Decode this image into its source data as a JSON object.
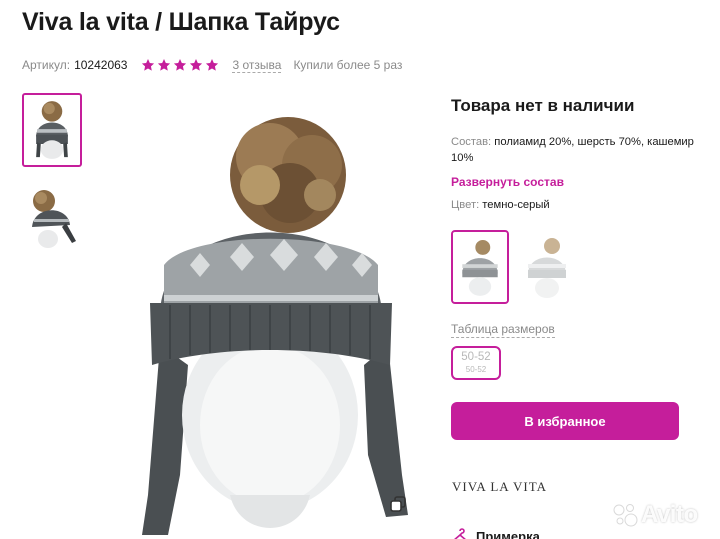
{
  "product": {
    "title": "Viva la vita / Шапка Тайрус",
    "sku_label": "Артикул:",
    "sku": "10242063",
    "rating": 5,
    "reviews": "3 отзыва",
    "bought": "Купили более 5 раз"
  },
  "icons": {
    "star": "star-icon",
    "copy": "copy-icon",
    "hanger": "hanger-icon"
  },
  "availability": "Товара нет в наличии",
  "composition": {
    "label": "Состав:",
    "value": "полиамид 20%, шерсть 70%, кашемир 10%",
    "expand": "Развернуть состав"
  },
  "color": {
    "label": "Цвет:",
    "value": "темно-серый"
  },
  "sizes": {
    "table_link": "Таблица размеров",
    "options": [
      {
        "label": "50-52",
        "sub": "50-52"
      }
    ]
  },
  "favorite_button": "В избранное",
  "brand_logo": "VIVA LA VITA",
  "fitting_label": "Примерка",
  "watermark": "Avito",
  "colors": {
    "accent": "#c51e9b",
    "text": "#1a1a1a",
    "muted": "#8a8a8a"
  }
}
